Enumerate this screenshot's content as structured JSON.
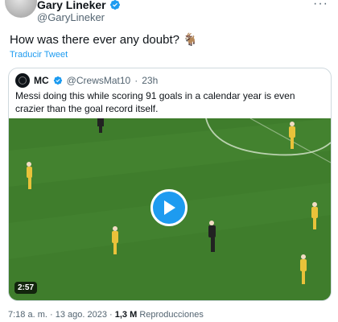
{
  "author": {
    "name": "Gary Lineker",
    "handle": "@GaryLineker",
    "avatar_icon": "avatar-icon",
    "verified_color": "#1d9bf0"
  },
  "tweet": {
    "text": "How was there ever any doubt? 🐐",
    "translate_label": "Traducir Tweet"
  },
  "quote": {
    "name": "MC",
    "handle": "@CrewsMat10",
    "separator": "·",
    "time": "23h",
    "text": "Messi doing this while scoring 91 goals in a calendar year is even crazier than the goal record itself.",
    "video": {
      "duration": "2:57",
      "play_color": "#1d9bf0"
    }
  },
  "footer": {
    "time": "7:18 a. m.",
    "separator": "·",
    "date": "13 ago. 2023",
    "views_count": "1,3 M",
    "views_label": "Reproducciones"
  }
}
